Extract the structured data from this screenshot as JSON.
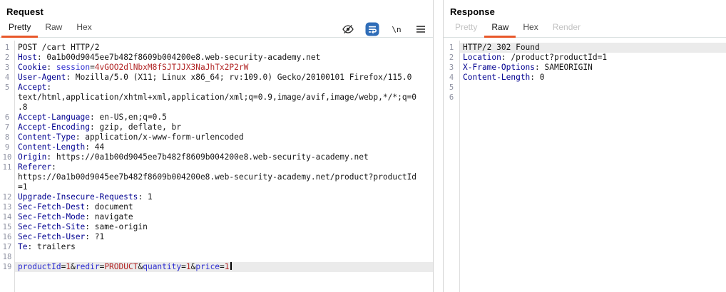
{
  "colors": {
    "accent_orange": "#e8582a",
    "header_name": "#000090",
    "param_name": "#2b2bd0",
    "param_value": "#b12424",
    "wrap_button_blue": "#2f6db8",
    "line_highlight": "#ebebeb"
  },
  "request": {
    "title": "Request",
    "tabs": [
      {
        "label": "Pretty",
        "state": "active"
      },
      {
        "label": "Raw",
        "state": "normal"
      },
      {
        "label": "Hex",
        "state": "normal"
      }
    ],
    "toolbar": {
      "icons": [
        "eye-slash-icon",
        "word-wrap-icon",
        "newline-icon",
        "menu-icon"
      ],
      "newline_glyph": "\\n"
    },
    "rows": [
      {
        "n": "1",
        "s": [
          [
            "t",
            "POST /cart HTTP/2"
          ]
        ]
      },
      {
        "n": "2",
        "s": [
          [
            "h",
            "Host"
          ],
          [
            "t",
            ": 0a1b00d9045ee7b482f8609b004200e8.web-security-academy.net"
          ]
        ]
      },
      {
        "n": "3",
        "s": [
          [
            "h",
            "Cookie"
          ],
          [
            "t",
            ": "
          ],
          [
            "n",
            "session"
          ],
          [
            "t",
            "="
          ],
          [
            "v",
            "4vGOO2dlNbxM8fSJTJJX3NaJhTx2P2rW"
          ]
        ]
      },
      {
        "n": "4",
        "s": [
          [
            "h",
            "User-Agent"
          ],
          [
            "t",
            ": Mozilla/5.0 (X11; Linux x86_64; rv:109.0) Gecko/20100101 Firefox/115.0"
          ]
        ]
      },
      {
        "n": "5",
        "s": [
          [
            "h",
            "Accept"
          ],
          [
            "t",
            ":"
          ]
        ]
      },
      {
        "n": "",
        "s": [
          [
            "t",
            "text/html,application/xhtml+xml,application/xml;q=0.9,image/avif,image/webp,*/*;q=0"
          ]
        ]
      },
      {
        "n": "",
        "s": [
          [
            "t",
            ".8"
          ]
        ]
      },
      {
        "n": "6",
        "s": [
          [
            "h",
            "Accept-Language"
          ],
          [
            "t",
            ": en-US,en;q=0.5"
          ]
        ]
      },
      {
        "n": "7",
        "s": [
          [
            "h",
            "Accept-Encoding"
          ],
          [
            "t",
            ": gzip, deflate, br"
          ]
        ]
      },
      {
        "n": "8",
        "s": [
          [
            "h",
            "Content-Type"
          ],
          [
            "t",
            ": application/x-www-form-urlencoded"
          ]
        ]
      },
      {
        "n": "9",
        "s": [
          [
            "h",
            "Content-Length"
          ],
          [
            "t",
            ": 44"
          ]
        ]
      },
      {
        "n": "10",
        "s": [
          [
            "h",
            "Origin"
          ],
          [
            "t",
            ": https://0a1b00d9045ee7b482f8609b004200e8.web-security-academy.net"
          ]
        ]
      },
      {
        "n": "11",
        "s": [
          [
            "h",
            "Referer"
          ],
          [
            "t",
            ":"
          ]
        ]
      },
      {
        "n": "",
        "s": [
          [
            "t",
            "https://0a1b00d9045ee7b482f8609b004200e8.web-security-academy.net/product?productId"
          ]
        ]
      },
      {
        "n": "",
        "s": [
          [
            "t",
            "=1"
          ]
        ]
      },
      {
        "n": "12",
        "s": [
          [
            "h",
            "Upgrade-Insecure-Requests"
          ],
          [
            "t",
            ": 1"
          ]
        ]
      },
      {
        "n": "13",
        "s": [
          [
            "h",
            "Sec-Fetch-Dest"
          ],
          [
            "t",
            ": document"
          ]
        ]
      },
      {
        "n": "14",
        "s": [
          [
            "h",
            "Sec-Fetch-Mode"
          ],
          [
            "t",
            ": navigate"
          ]
        ]
      },
      {
        "n": "15",
        "s": [
          [
            "h",
            "Sec-Fetch-Site"
          ],
          [
            "t",
            ": same-origin"
          ]
        ]
      },
      {
        "n": "16",
        "s": [
          [
            "h",
            "Sec-Fetch-User"
          ],
          [
            "t",
            ": ?1"
          ]
        ]
      },
      {
        "n": "17",
        "s": [
          [
            "h",
            "Te"
          ],
          [
            "t",
            ": trailers"
          ]
        ]
      },
      {
        "n": "18",
        "s": []
      },
      {
        "n": "19",
        "hl": true,
        "caret": true,
        "s": [
          [
            "n",
            "productId"
          ],
          [
            "t",
            "="
          ],
          [
            "v",
            "1"
          ],
          [
            "t",
            "&"
          ],
          [
            "n",
            "redir"
          ],
          [
            "t",
            "="
          ],
          [
            "v",
            "PRODUCT"
          ],
          [
            "t",
            "&"
          ],
          [
            "n",
            "quantity"
          ],
          [
            "t",
            "="
          ],
          [
            "v",
            "1"
          ],
          [
            "t",
            "&"
          ],
          [
            "n",
            "price"
          ],
          [
            "t",
            "="
          ],
          [
            "v",
            "1"
          ]
        ]
      }
    ]
  },
  "response": {
    "title": "Response",
    "tabs": [
      {
        "label": "Pretty",
        "state": "disabled"
      },
      {
        "label": "Raw",
        "state": "active"
      },
      {
        "label": "Hex",
        "state": "normal"
      },
      {
        "label": "Render",
        "state": "disabled"
      }
    ],
    "rows": [
      {
        "n": "1",
        "hl": true,
        "s": [
          [
            "t",
            "HTTP/2 302 Found"
          ]
        ]
      },
      {
        "n": "2",
        "s": [
          [
            "h",
            "Location"
          ],
          [
            "t",
            ": /product?productId=1"
          ]
        ]
      },
      {
        "n": "3",
        "s": [
          [
            "h",
            "X-Frame-Options"
          ],
          [
            "t",
            ": SAMEORIGIN"
          ]
        ]
      },
      {
        "n": "4",
        "s": [
          [
            "h",
            "Content-Length"
          ],
          [
            "t",
            ": 0"
          ]
        ]
      },
      {
        "n": "5",
        "s": []
      },
      {
        "n": "6",
        "s": []
      }
    ]
  }
}
